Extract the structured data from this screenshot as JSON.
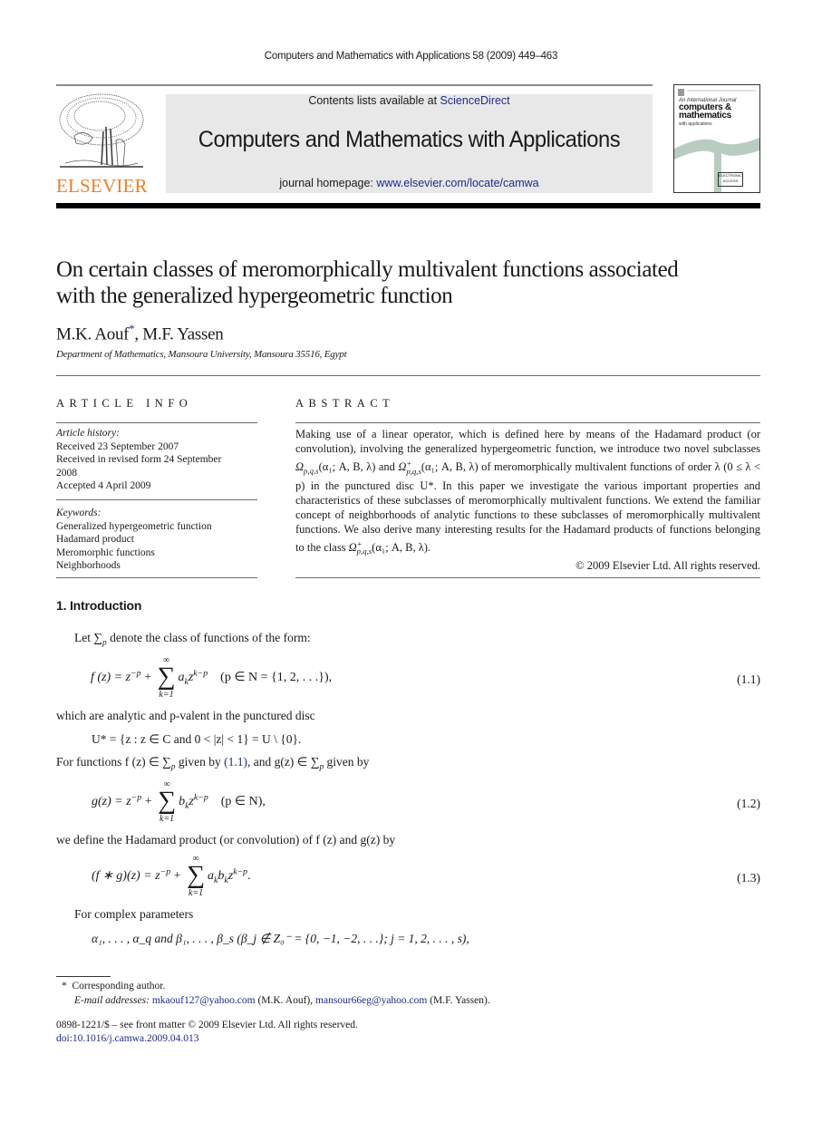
{
  "running_header": "Computers and Mathematics with Applications 58 (2009) 449–463",
  "masthead": {
    "publisher_logo_text": "ELSEVIER",
    "contents_prefix": "Contents lists available at ",
    "contents_link": "ScienceDirect",
    "journal_name": "Computers and Mathematics with Applications",
    "homepage_prefix": "journal homepage: ",
    "homepage_link": "www.elsevier.com/locate/camwa",
    "cover": {
      "line1": "An International Journal",
      "line2a": "computers &",
      "line2b": "mathematics",
      "line3": "with applications",
      "badge": "ELECTRONIC ACCESS"
    },
    "colors": {
      "elsevier_orange": "#f07e26",
      "link_blue": "#1f2a8c",
      "band_grey": "#e8e8e8"
    }
  },
  "article": {
    "title_line1": "On certain classes of meromorphically multivalent functions associated",
    "title_line2": "with the generalized hypergeometric function",
    "author1": "M.K. Aouf",
    "author1_mark": "*",
    "author_sep": ", ",
    "author2": "M.F. Yassen",
    "affiliation": "Department of Mathematics, Mansoura University, Mansoura 35516, Egypt"
  },
  "article_info": {
    "heading": "ARTICLE INFO",
    "history_label": "Article history:",
    "history": [
      "Received 23 September 2007",
      "Received in revised form 24 September",
      "2008",
      "Accepted 4 April 2009"
    ],
    "keywords_label": "Keywords:",
    "keywords": [
      "Generalized hypergeometric function",
      "Hadamard product",
      "Meromorphic functions",
      "Neighborhoods"
    ]
  },
  "abstract": {
    "heading": "ABSTRACT",
    "part1": "Making use of a linear operator, which is defined here by means of the Hadamard product (or convolution), involving the generalized hypergeometric function, we introduce two novel subclasses ",
    "class1": "Ω",
    "class_sub": "p,q,s",
    "class_plus": "+",
    "class_args": "(α₁; A, B, λ)",
    "and": " and ",
    "part2": " of meromorphically multivalent functions of order λ (0 ≤ λ < p) in the punctured disc U*. In this paper we investigate the various important properties and characteristics of these subclasses of meromorphically multivalent functions. We extend the familiar concept of neighborhoods of analytic functions to these subclasses of meromorphically multivalent functions. We also derive many interesting results for the Hadamard products of functions belonging to the class ",
    "part3": ".",
    "copyright": "© 2009 Elsevier Ltd. All rights reserved."
  },
  "body": {
    "section_heading": "1. Introduction",
    "p1_let": "Let ",
    "p1_rest": " denote the class of functions of the form:",
    "eq1_lhs": "f (z) = z",
    "eq1_sup": "−p",
    "eq1_plus": " + ",
    "eq1_term": "a",
    "eq1_cond": "(p ∈ N = {1, 2, . . .}),",
    "eq1_num": "(1.1)",
    "p2": "which are analytic and p-valent in the punctured disc",
    "eq_disc": "U* = {z : z ∈ C and 0 < |z| < 1} = U \\ {0}.",
    "p3_a": "For functions f (z) ∈ ∑",
    "p3_b": " given by ",
    "p3_ref": "(1.1)",
    "p3_c": ", and g(z) ∈ ∑",
    "p3_d": " given by",
    "eq2_lhs": "g(z) = z",
    "eq2_cond": "(p ∈ N),",
    "eq2_num": "(1.2)",
    "p4": "we define the Hadamard product (or convolution) of f (z) and g(z) by",
    "eq3_lhs": "(f ∗ g)(z) = z",
    "eq3_num": "(1.3)",
    "p5": "For complex parameters",
    "eq4": "α₁, . . . , α_q   and   β₁, . . . , β_s   (β_j ∉ Z₀⁻ = {0, −1, −2, . . .}; j = 1, 2, . . . , s),",
    "sum_top": "∞",
    "sum_bot": "k=1",
    "sum_sym": "∑",
    "p_sub": "p",
    "kp_sup": "k−p",
    "k_sub": "k"
  },
  "footnotes": {
    "mark": "*",
    "corresponding": "Corresponding author.",
    "email_label": "E-mail addresses: ",
    "email1": "mkaouf127@yahoo.com",
    "email1_name": " (M.K. Aouf), ",
    "email2": "mansour66eg@yahoo.com",
    "email2_name": " (M.F. Yassen).",
    "front_matter": "0898-1221/$ – see front matter © 2009 Elsevier Ltd. All rights reserved.",
    "doi": "doi:10.1016/j.camwa.2009.04.013"
  }
}
